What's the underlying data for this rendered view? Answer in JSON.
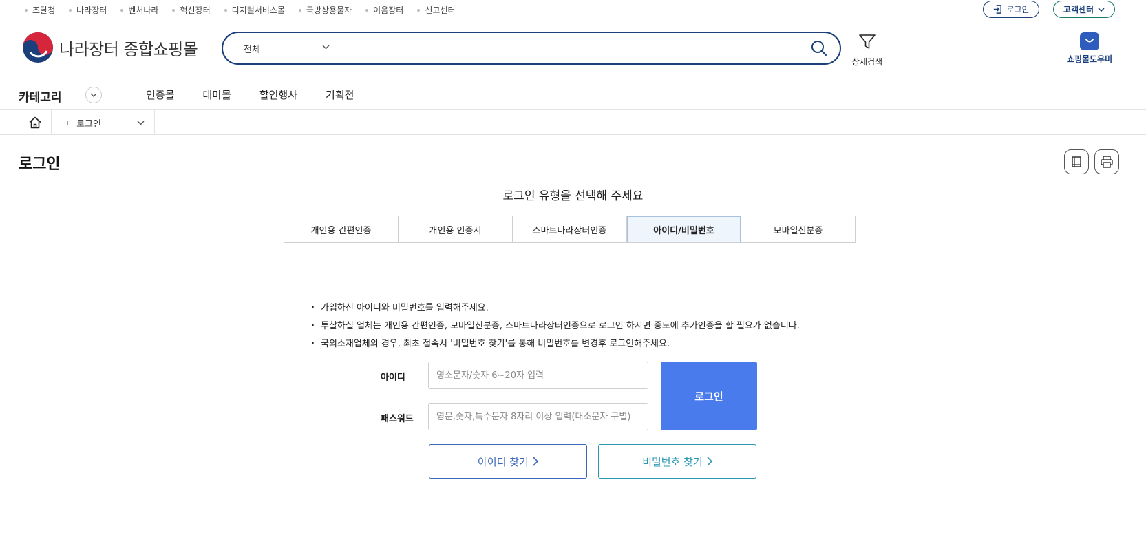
{
  "util_links": [
    "조달청",
    "나라장터",
    "벤처나라",
    "혁신장터",
    "디지털서비스몰",
    "국방상용물자",
    "이음장터",
    "신고센터"
  ],
  "top_login_label": "로그인",
  "customer_center_label": "고객센터",
  "logo_text": "나라장터 종합쇼핑몰",
  "search": {
    "scope": "전체",
    "value": ""
  },
  "detail_search_label": "상세검색",
  "helper_label": "쇼핑몰도우미",
  "nav": {
    "category_label": "카테고리",
    "items": [
      "인증몰",
      "테마몰",
      "할인행사",
      "기획전"
    ]
  },
  "breadcrumb": {
    "current": "ㄴ 로그인"
  },
  "page_title": "로그인",
  "login_type": {
    "heading": "로그인 유형을 선택해 주세요",
    "tabs": [
      "개인용 간편인증",
      "개인용 인증서",
      "스마트나라장터인증",
      "아이디/비밀번호",
      "모바일신분증"
    ],
    "active_index": 3
  },
  "notices": [
    "가입하신 아이디와 비밀번호를 입력해주세요.",
    "투찰하실 업체는 개인용 간편인증, 모바일신분증, 스마트나라장터인증으로 로그인 하시면 중도에 추가인증을 할 필요가 없습니다.",
    "국외소재업체의 경우, 최초 접속시 '비밀번호 찾기'를 통해 비밀번호를 변경후 로그인해주세요."
  ],
  "form": {
    "id_label": "아이디",
    "id_placeholder": "영소문자/숫자 6~20자 입력",
    "pw_label": "패스워드",
    "pw_placeholder": "영문,숫자,특수문자 8자리 이상 입력(대소문자 구별)",
    "login_button": "로그인",
    "find_id": "아이디 찾기",
    "find_pw": "비밀번호 찾기"
  },
  "colors": {
    "primary": "#1a3f7a",
    "login_button": "#4a7bed",
    "find_id": "#3a66b8",
    "find_pw": "#2a98b3",
    "active_tab_bg": "#eef5fc"
  }
}
